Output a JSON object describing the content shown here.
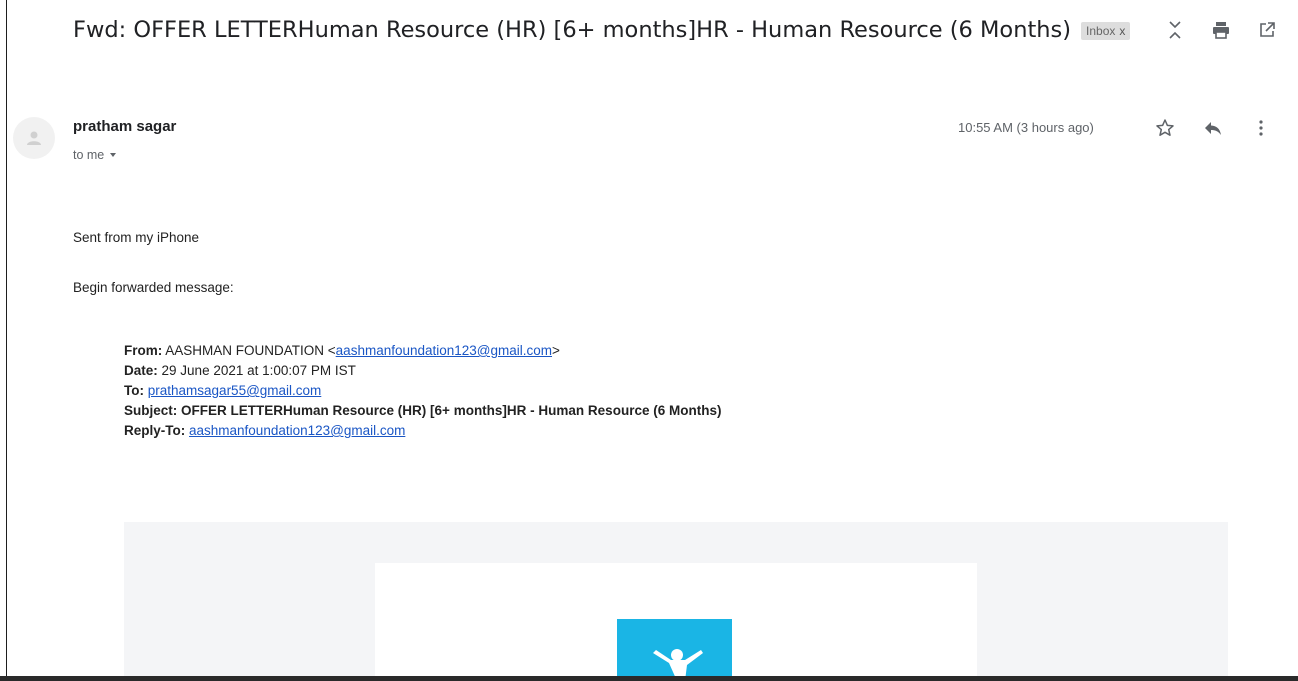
{
  "email": {
    "subject": "Fwd: OFFER LETTERHuman Resource (HR) [6+ months]HR - Human Resource (6 Months)",
    "label": "Inbox",
    "label_close": "x",
    "top_actions": [
      "expand-collapse-icon",
      "print-icon",
      "open-in-new-window-icon"
    ],
    "sender": "pratham sagar",
    "recipient": "to me",
    "timestamp": "10:55 AM (3 hours ago)",
    "row_actions": [
      "star-icon",
      "reply-icon",
      "more-options-icon"
    ],
    "body_line_1": "Sent from my iPhone",
    "body_line_2": "Begin forwarded message:"
  },
  "forwarded": {
    "from_label": "From:",
    "from_name": "AASHMAN FOUNDATION <",
    "from_email": "aashmanfoundation123@gmail.com",
    "from_close": ">",
    "date_label": "Date:",
    "date_value": "29 June 2021 at 1:00:07 PM IST",
    "to_label": "To:",
    "to_email": "prathamsagar55@gmail.com",
    "subject_label": "Subject:",
    "subject_value": "OFFER LETTERHuman Resource (HR) [6+ months]HR - Human Resource (6 Months)",
    "reply_to_label": "Reply-To:",
    "reply_to_email": "aashmanfoundation123@gmail.com"
  },
  "colors": {
    "link": "#1a56c5",
    "logo_bg": "#1ab5e5",
    "embed_bg": "#f4f5f7"
  }
}
